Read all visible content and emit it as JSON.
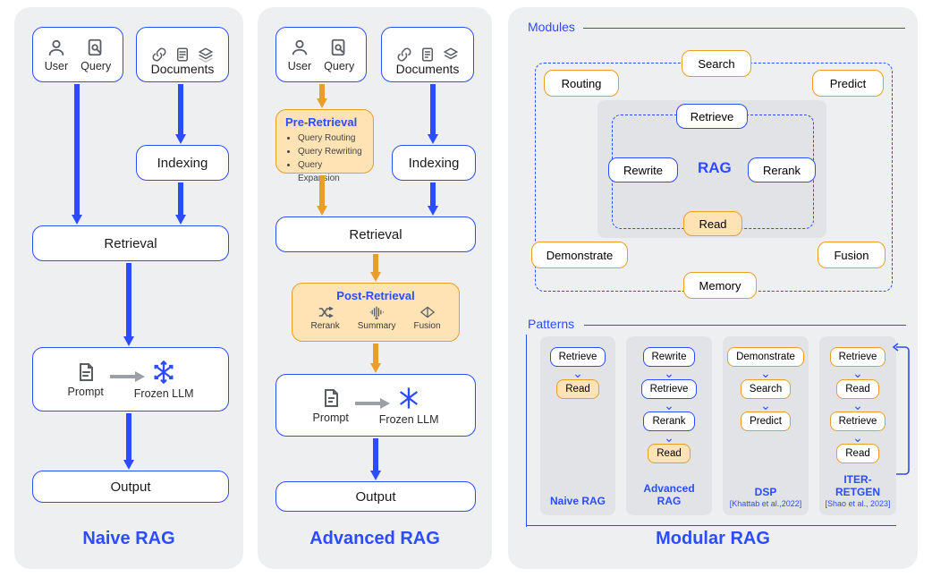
{
  "panels": {
    "naive": {
      "title": "Naive RAG",
      "user_label": "User",
      "query_label": "Query",
      "documents_label": "Documents",
      "indexing_label": "Indexing",
      "retrieval_label": "Retrieval",
      "prompt_label": "Prompt",
      "frozen_label": "Frozen LLM",
      "output_label": "Output"
    },
    "advanced": {
      "title": "Advanced RAG",
      "user_label": "User",
      "query_label": "Query",
      "documents_label": "Documents",
      "indexing_label": "Indexing",
      "retrieval_label": "Retrieval",
      "prompt_label": "Prompt",
      "frozen_label": "Frozen LLM",
      "output_label": "Output",
      "pre_title": "Pre-Retrieval",
      "pre_items": [
        "Query Routing",
        "Query Rewriting",
        "Query Expansion"
      ],
      "post_title": "Post-Retrieval",
      "post_rerank": "Rerank",
      "post_summary": "Summary",
      "post_fusion": "Fusion"
    },
    "modular": {
      "title": "Modular RAG",
      "modules_label": "Modules",
      "patterns_label": "Patterns",
      "rag_label": "RAG",
      "mods": {
        "routing": "Routing",
        "search": "Search",
        "predict": "Predict",
        "retrieve": "Retrieve",
        "rewrite": "Rewrite",
        "rerank": "Rerank",
        "read": "Read",
        "demonstrate": "Demonstrate",
        "fusion": "Fusion",
        "memory": "Memory"
      },
      "patterns": {
        "col1": {
          "name": "Naive RAG",
          "note": "",
          "steps": [
            {
              "t": "Retrieve",
              "k": "b"
            },
            {
              "t": "Read",
              "k": "o"
            }
          ]
        },
        "col2": {
          "name": "Advanced RAG",
          "note": "",
          "steps": [
            {
              "t": "Rewrite",
              "k": "b"
            },
            {
              "t": "Retrieve",
              "k": "b"
            },
            {
              "t": "Rerank",
              "k": "b"
            },
            {
              "t": "Read",
              "k": "o"
            }
          ]
        },
        "col3": {
          "name": "DSP",
          "note": "[Khattab et al.,2022]",
          "steps": [
            {
              "t": "Demonstrate",
              "k": "ow"
            },
            {
              "t": "Search",
              "k": "ow"
            },
            {
              "t": "Predict",
              "k": "ow"
            }
          ]
        },
        "col4": {
          "name": "ITER-RETGEN",
          "note": "[Shao et al., 2023]",
          "steps": [
            {
              "t": "Retrieve",
              "k": "ow"
            },
            {
              "t": "Read",
              "k": "ow"
            },
            {
              "t": "Retrieve",
              "k": "ow"
            },
            {
              "t": "Read",
              "k": "ow"
            }
          ]
        }
      }
    }
  }
}
